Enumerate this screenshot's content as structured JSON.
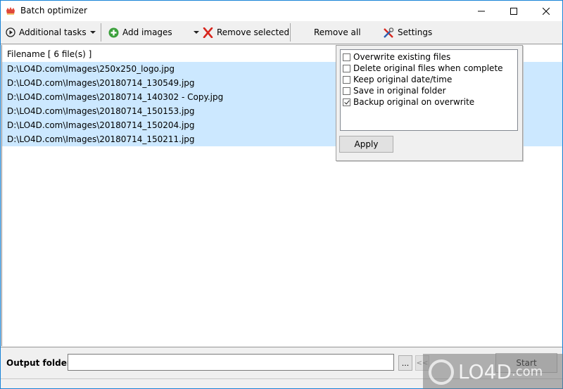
{
  "window": {
    "title": "Batch optimizer",
    "controls": {
      "minimize": "minimize",
      "maximize": "maximize",
      "close": "close"
    }
  },
  "toolbar": {
    "additional_tasks": "Additional tasks",
    "add_images": "Add images",
    "remove_selected": "Remove selected",
    "remove_all": "Remove all",
    "settings": "Settings"
  },
  "file_list": {
    "header": "Filename [ 6 file(s) ]",
    "files": [
      "D:\\LO4D.com\\Images\\250x250_logo.jpg",
      "D:\\LO4D.com\\Images\\20180714_130549.jpg",
      "D:\\LO4D.com\\Images\\20180714_140302 - Copy.jpg",
      "D:\\LO4D.com\\Images\\20180714_150153.jpg",
      "D:\\LO4D.com\\Images\\20180714_150204.jpg",
      "D:\\LO4D.com\\Images\\20180714_150211.jpg"
    ],
    "selection_color": "#cce8ff"
  },
  "settings_popup": {
    "options": [
      {
        "label": "Overwrite existing files",
        "checked": false
      },
      {
        "label": "Delete original files when complete",
        "checked": false
      },
      {
        "label": "Keep original date/time",
        "checked": false
      },
      {
        "label": "Save in original folder",
        "checked": false
      },
      {
        "label": "Backup original on overwrite",
        "checked": true
      }
    ],
    "apply_label": "Apply"
  },
  "bottom": {
    "output_label": "Output folder:",
    "output_value": "",
    "browse_label": "...",
    "collapse_label": "<<",
    "start_label": "Start"
  },
  "watermark": {
    "text_main": "LO4D",
    "text_suffix": ".com"
  }
}
